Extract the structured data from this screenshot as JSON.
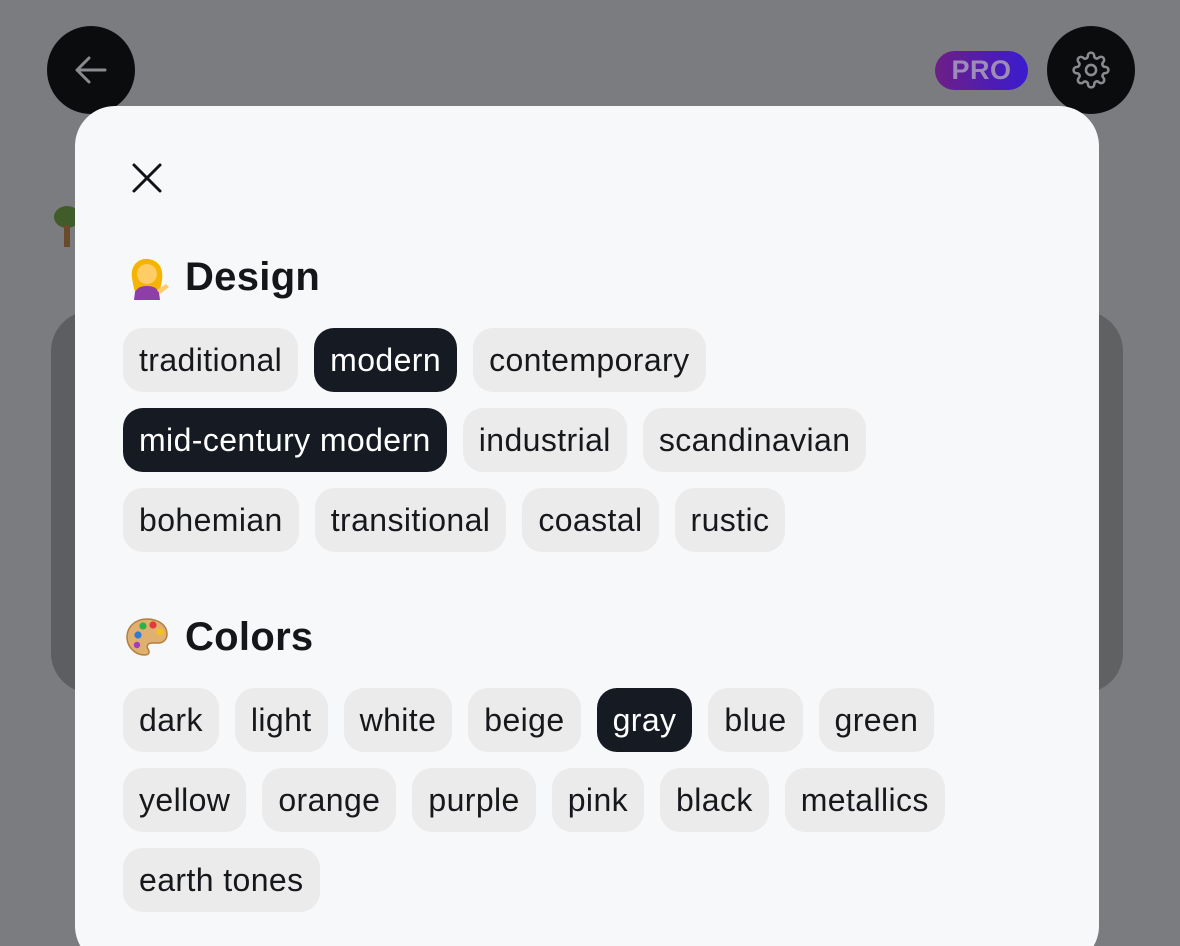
{
  "header": {
    "back_icon": "arrow-left-icon",
    "pro_badge": "PRO",
    "settings_icon": "gear-icon",
    "pro_gradient": [
      "#6d1f86",
      "#3a1bd0"
    ]
  },
  "modal": {
    "close_icon": "close-icon",
    "sections": [
      {
        "emoji_icon": "person-tipping-hand-emoji",
        "title": "Design",
        "chips": [
          {
            "label": "traditional",
            "selected": false
          },
          {
            "label": "modern",
            "selected": true
          },
          {
            "label": "contemporary",
            "selected": false
          },
          {
            "label": "mid-century modern",
            "selected": true
          },
          {
            "label": "industrial",
            "selected": false
          },
          {
            "label": "scandinavian",
            "selected": false
          },
          {
            "label": "bohemian",
            "selected": false
          },
          {
            "label": "transitional",
            "selected": false
          },
          {
            "label": "coastal",
            "selected": false
          },
          {
            "label": "rustic",
            "selected": false
          }
        ]
      },
      {
        "emoji_icon": "artist-palette-emoji",
        "title": "Colors",
        "chips": [
          {
            "label": "dark",
            "selected": false
          },
          {
            "label": "light",
            "selected": false
          },
          {
            "label": "white",
            "selected": false
          },
          {
            "label": "beige",
            "selected": false
          },
          {
            "label": "gray",
            "selected": true
          },
          {
            "label": "blue",
            "selected": false
          },
          {
            "label": "green",
            "selected": false
          },
          {
            "label": "yellow",
            "selected": false
          },
          {
            "label": "orange",
            "selected": false
          },
          {
            "label": "purple",
            "selected": false
          },
          {
            "label": "pink",
            "selected": false
          },
          {
            "label": "black",
            "selected": false
          },
          {
            "label": "metallics",
            "selected": false
          },
          {
            "label": "earth tones",
            "selected": false
          }
        ]
      }
    ]
  },
  "colors": {
    "chip_bg": "#ebebeb",
    "chip_selected_bg": "#161a22",
    "modal_bg": "#f7f8fa",
    "overlay_bg": "#7b7c7f"
  }
}
